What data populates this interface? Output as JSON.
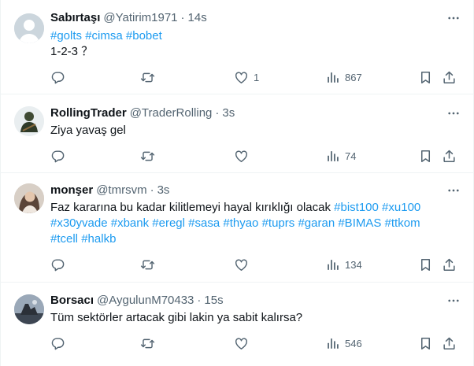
{
  "tweets": [
    {
      "name": "Sabırtaşı",
      "handle": "@Yatirim1971",
      "time": "14s",
      "hashtags": [
        "#golts",
        "#cimsa",
        "#bobet"
      ],
      "text": "1-2-3 ？",
      "likes": "1",
      "views": "867"
    },
    {
      "name": "RollingTrader",
      "handle": "@TraderRolling",
      "time": "3s",
      "text": "Ziya yavaş gel",
      "views": "74"
    },
    {
      "name": "monşer",
      "handle": "@tmrsvm",
      "time": "3s",
      "text_prefix": "Faz kararına bu kadar kilitlemeyi hayal kırıklığı olacak",
      "hashtags": [
        "#bist100",
        "#xu100",
        "#x30yvade",
        "#xbank",
        "#eregl",
        "#sasa",
        "#thyao",
        "#tuprs",
        "#garan",
        "#BIMAS",
        "#ttkom",
        "#tcell",
        "#halkb"
      ],
      "views": "134"
    },
    {
      "name": "Borsacı",
      "handle": "@AygulunM70433",
      "time": "15s",
      "text": "Tüm sektörler artacak gibi lakin ya sabit kalırsa?",
      "views": "546"
    }
  ],
  "separator": "·",
  "icons": {
    "more": "more-horizontal-icon",
    "reply": "reply-icon",
    "retweet": "retweet-icon",
    "like": "heart-icon",
    "views": "views-chart-icon",
    "bookmark": "bookmark-icon",
    "share": "share-icon"
  },
  "colors": {
    "text": "#0f1419",
    "secondary": "#536471",
    "link": "#1d9bf0",
    "divider": "#eff3f4"
  }
}
